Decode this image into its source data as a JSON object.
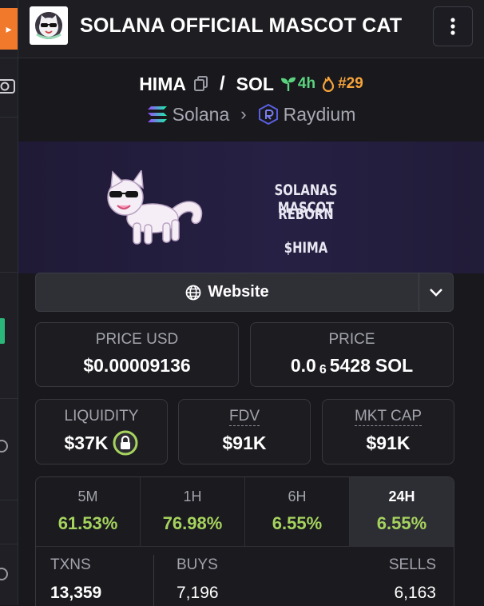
{
  "header": {
    "title": "SOLANA OFFICIAL MASCOT CAT",
    "menu_icon": "kebab-vertical-icon"
  },
  "pair": {
    "base": "HIMA",
    "quote": "SOL",
    "age": "4h",
    "rank": "#29",
    "chain": "Solana",
    "dex": "Raydium"
  },
  "banner": {
    "line1": "SOLANAS MASCOT",
    "line2": "REBORN",
    "line3": "$HIMA"
  },
  "website": {
    "label": "Website"
  },
  "price_usd": {
    "label": "PRICE USD",
    "value": "$0.00009136"
  },
  "price_native": {
    "label": "PRICE",
    "prefix": "0.0",
    "zeros": "6",
    "digits": "5428",
    "unit": "SOL"
  },
  "liquidity": {
    "label": "LIQUIDITY",
    "value": "$37K"
  },
  "fdv": {
    "label": "FDV",
    "value": "$91K"
  },
  "mkt_cap": {
    "label": "MKT CAP",
    "value": "$91K"
  },
  "timeframes": [
    {
      "label": "5M",
      "value": "61.53%"
    },
    {
      "label": "1H",
      "value": "76.98%"
    },
    {
      "label": "6H",
      "value": "6.55%"
    },
    {
      "label": "24H",
      "value": "6.55%"
    }
  ],
  "txns": {
    "label": "TXNS",
    "value": "13,359"
  },
  "buys": {
    "label": "BUYS",
    "value": "7,196"
  },
  "sells": {
    "label": "SELLS",
    "value": "6,163"
  },
  "colors": {
    "accent_green": "#a6d35e",
    "age_green": "#5bd37e",
    "rank_orange": "#f7a43a",
    "tab_orange": "#f0792c"
  }
}
